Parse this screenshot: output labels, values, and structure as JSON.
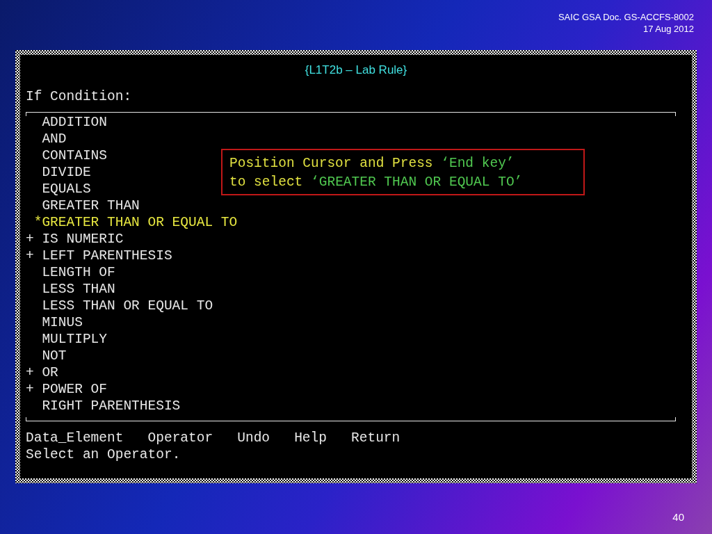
{
  "header": {
    "document": "SAIC GSA Doc. GS-ACCFS-8002",
    "date": "17 Aug 2012"
  },
  "terminal": {
    "title": "{L1T2b – Lab Rule}",
    "prompt": "If Condition:",
    "operators": [
      {
        "label": "ADDITION",
        "selected": false
      },
      {
        "label": "AND",
        "selected": false
      },
      {
        "label": "CONTAINS",
        "selected": false
      },
      {
        "label": "DIVIDE",
        "selected": false
      },
      {
        "label": "EQUALS",
        "selected": false
      },
      {
        "label": "GREATER THAN",
        "selected": false
      },
      {
        "marker": "*",
        "label": "GREATER THAN OR EQUAL TO",
        "selected": true
      },
      {
        "marker": "+",
        "label": "IS NUMERIC",
        "selected": false
      },
      {
        "marker": "+",
        "label": "LEFT PARENTHESIS",
        "selected": false
      },
      {
        "label": "LENGTH OF",
        "selected": false
      },
      {
        "label": "LESS THAN",
        "selected": false
      },
      {
        "label": "LESS THAN OR EQUAL TO",
        "selected": false
      },
      {
        "label": "MINUS",
        "selected": false
      },
      {
        "label": "MULTIPLY",
        "selected": false
      },
      {
        "label": "NOT",
        "selected": false
      },
      {
        "marker": "+",
        "label": "OR",
        "selected": false
      },
      {
        "marker": "+",
        "label": "POWER OF",
        "selected": false
      },
      {
        "label": "RIGHT PARENTHESIS",
        "selected": false
      }
    ],
    "menu": [
      "Data_Element",
      "Operator",
      "Undo",
      "Help",
      "Return"
    ],
    "status": "Select an Operator."
  },
  "callout": {
    "lines": [
      [
        {
          "kind": "plain",
          "text": "Position Cursor and Press "
        },
        {
          "kind": "key",
          "text": "‘End key’"
        }
      ],
      [
        {
          "kind": "plain",
          "text": "to select "
        },
        {
          "kind": "key",
          "text": "‘GREATER THAN OR EQUAL TO’"
        }
      ]
    ]
  },
  "page_number": "40"
}
